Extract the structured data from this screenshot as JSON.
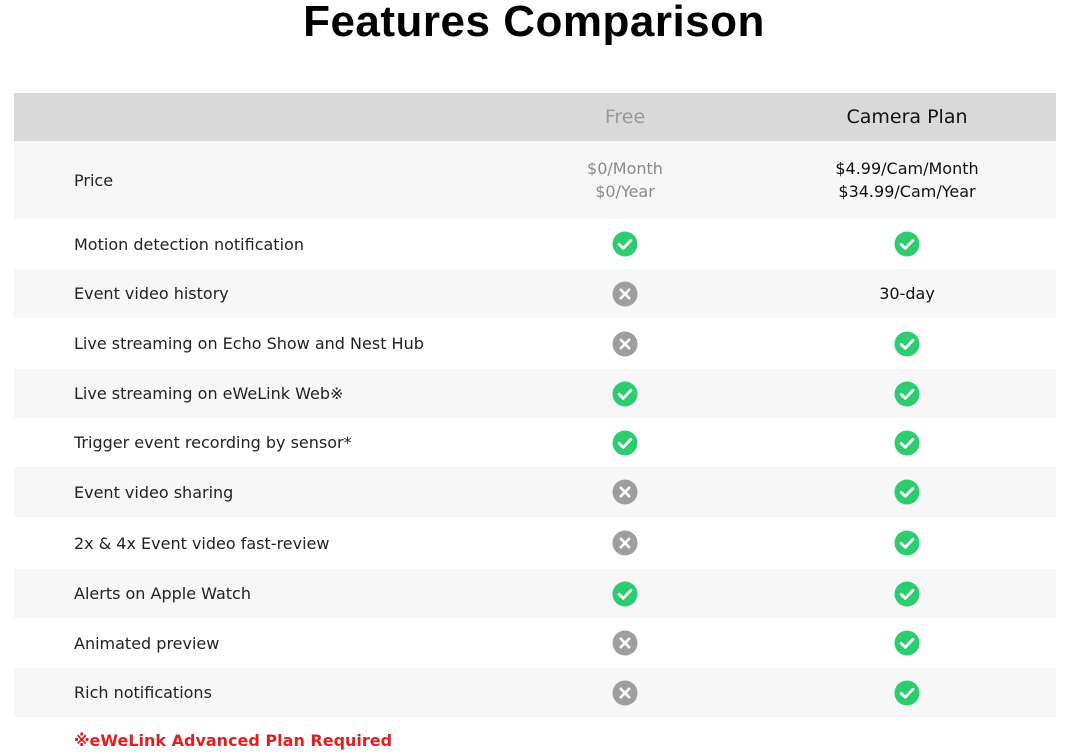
{
  "title": "Features Comparison",
  "columns": {
    "free": "Free",
    "camera": "Camera Plan"
  },
  "price": {
    "label": "Price",
    "free_month": "$0/Month",
    "free_year": "$0/Year",
    "camera_month": "$4.99/Cam/Month",
    "camera_year": "$34.99/Cam/Year"
  },
  "rows": [
    {
      "label": "Motion detection notification",
      "free": "check-icon",
      "camera": "check-icon"
    },
    {
      "label": "Event video history",
      "free": "cross-icon",
      "camera_text": "30-day"
    },
    {
      "label": "Live streaming on Echo Show and Nest Hub",
      "free": "cross-icon",
      "camera": "check-icon"
    },
    {
      "label": "Live streaming on eWeLink Web※",
      "free": "check-icon",
      "camera": "check-icon"
    },
    {
      "label": "Trigger event recording by sensor*",
      "free": "check-icon",
      "camera": "check-icon"
    },
    {
      "label": "Event video sharing",
      "free": "cross-icon",
      "camera": "check-icon"
    },
    {
      "label": "2x & 4x Event video fast-review",
      "free": "cross-icon",
      "camera": "check-icon"
    },
    {
      "label": "Alerts on Apple Watch",
      "free": "check-icon",
      "camera": "check-icon"
    },
    {
      "label": "Animated preview",
      "free": "cross-icon",
      "camera": "check-icon"
    },
    {
      "label": "Rich notifications",
      "free": "cross-icon",
      "camera": "check-icon"
    }
  ],
  "footnote": "※eWeLink Advanced Plan Required",
  "colors": {
    "check": "#2ecc71",
    "cross": "#9e9e9e",
    "header_bg": "#d9d9d9",
    "footnote": "#e02020"
  }
}
